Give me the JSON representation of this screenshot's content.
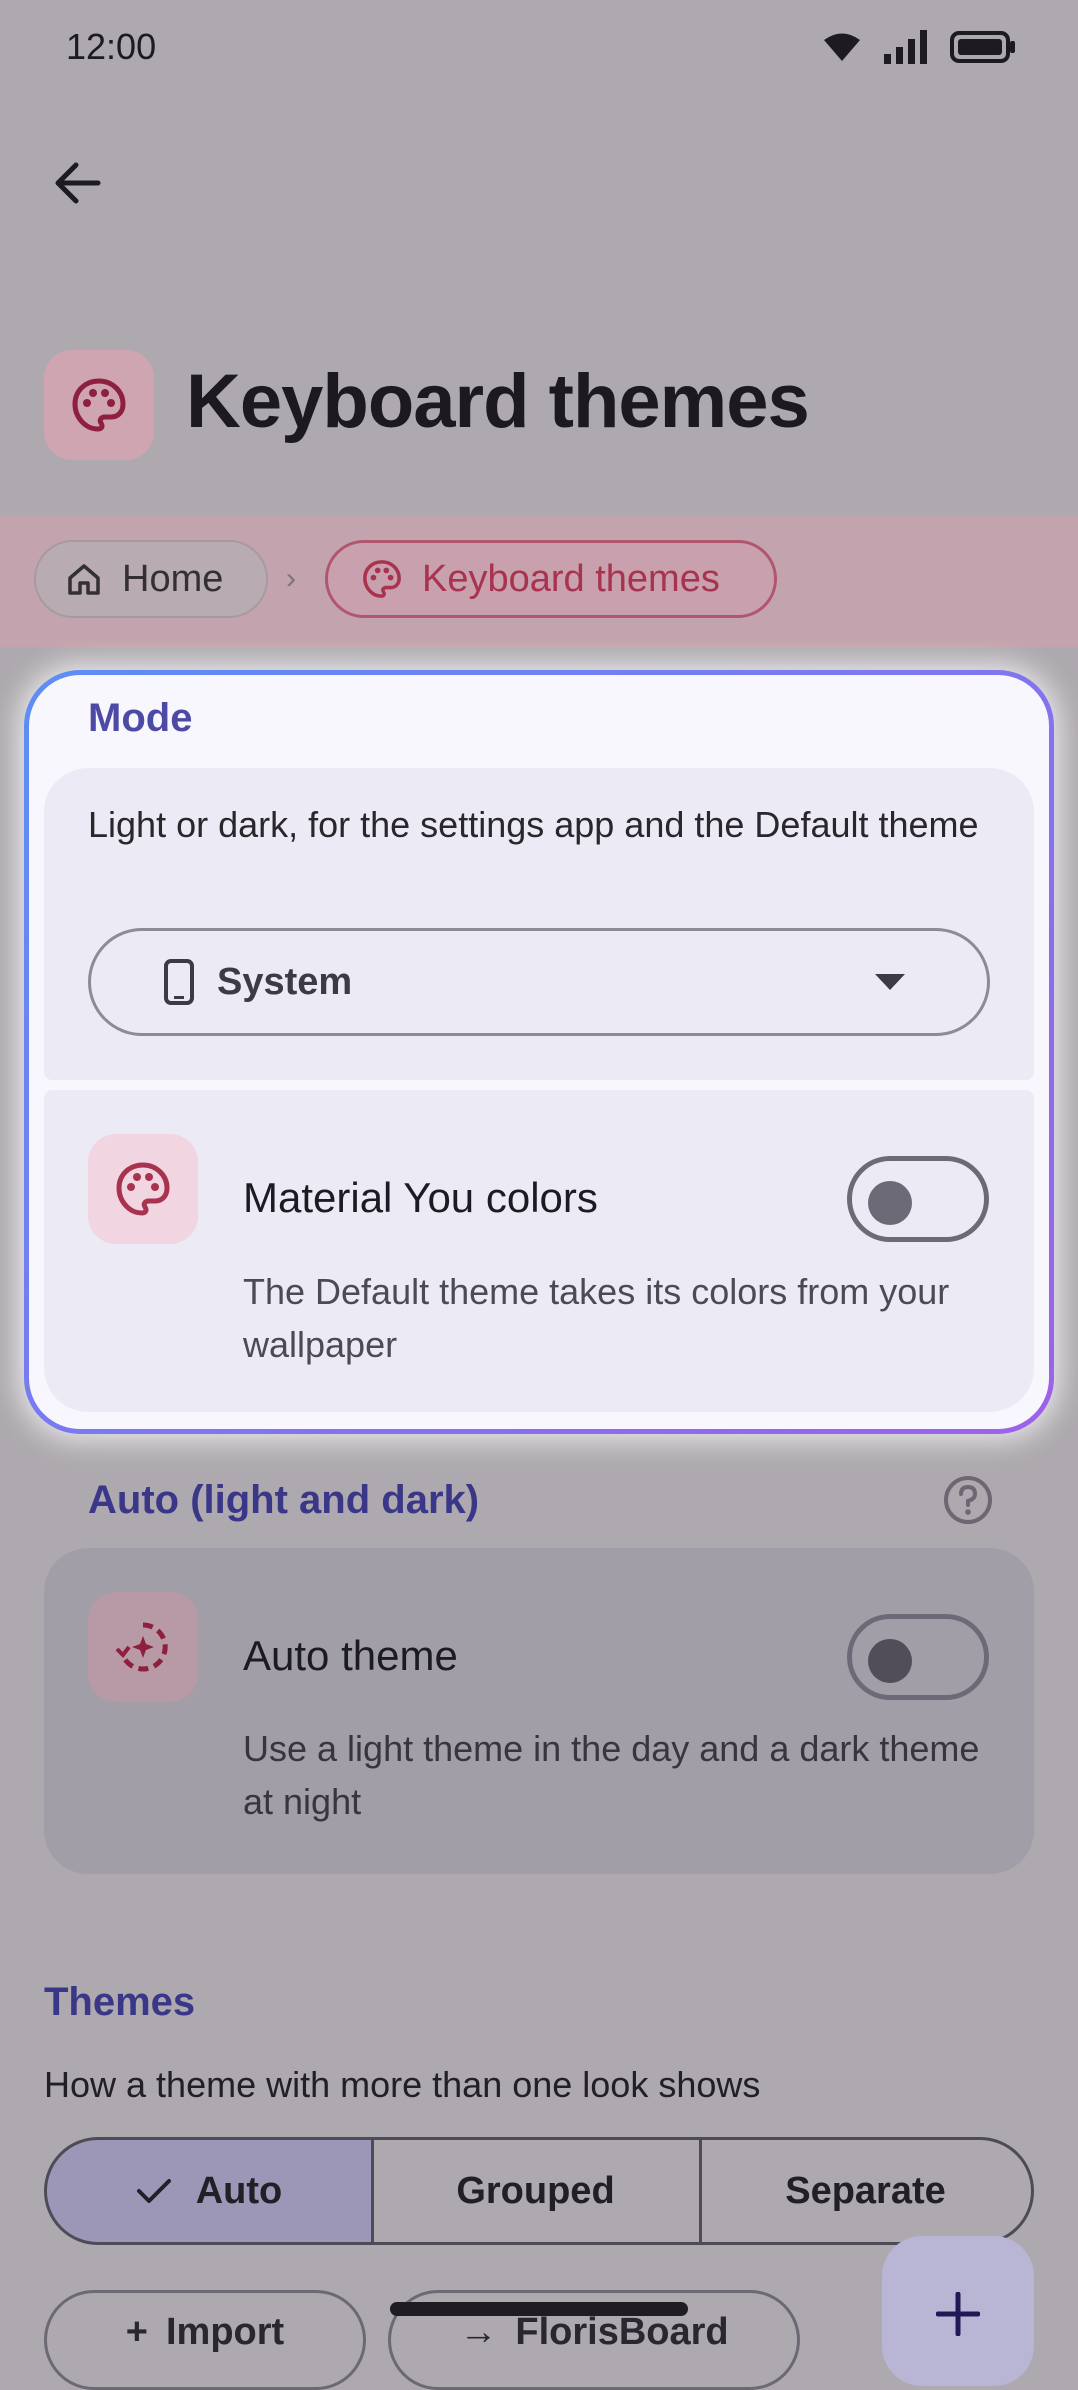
{
  "status_bar": {
    "time": "12:00"
  },
  "app_bar": {
    "title": "Keyboard themes"
  },
  "breadcrumb": {
    "home": "Home",
    "separator": "›",
    "current": "Keyboard themes"
  },
  "mode_section": {
    "label": "Mode",
    "description": "Light or dark, for the settings app and the Default theme",
    "selected_option": "System",
    "material_you": {
      "title": "Material You colors",
      "subtitle": "The Default theme takes its colors from your wallpaper",
      "enabled": false
    }
  },
  "auto_section": {
    "label": "Auto (light and dark)",
    "auto_theme": {
      "title": "Auto theme",
      "subtitle": "Use a light theme in the day and a dark theme at night",
      "enabled": false
    }
  },
  "themes_section": {
    "label": "Themes",
    "description": "How a theme with more than one look shows",
    "segments": [
      "Auto",
      "Grouped",
      "Separate"
    ],
    "selected_segment": "Auto",
    "buttons": [
      "Import",
      "FlorisBoard"
    ]
  },
  "colors": {
    "accent": "#4d4aa6",
    "brand_pink": "#a8334f",
    "card_border_start": "#5d8ef5",
    "card_border_end": "#9d62ea"
  }
}
